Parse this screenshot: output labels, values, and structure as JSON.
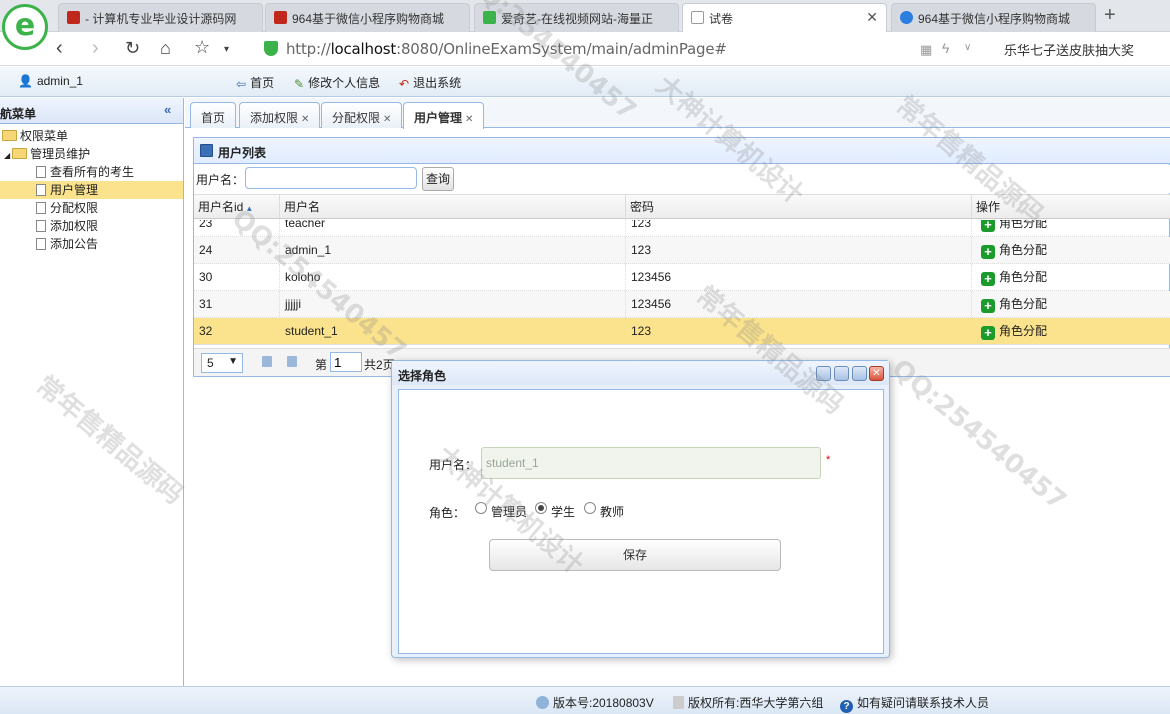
{
  "browser": {
    "tabs": [
      {
        "title": "- 计算机专业毕业设计源码网",
        "favicon_color": "#c0281b"
      },
      {
        "title": "964基于微信小程序购物商城",
        "favicon_color": "#c0281b"
      },
      {
        "title": "爱奇艺-在线视频网站-海量正",
        "favicon_color": "#3cb34a"
      },
      {
        "title": "试卷",
        "favicon_color": "#999999",
        "active": true
      },
      {
        "title": "964基于微信小程序购物商城",
        "favicon_color": "#2a7ee0"
      }
    ],
    "url_prefix": "http://",
    "url_host": "localhost",
    "url_rest": ":8080/OnlineExamSystem/main/adminPage#",
    "promo": "乐华七子送皮肤抽大奖"
  },
  "header": {
    "user": "admin_1",
    "home": "首页",
    "edit_profile": "修改个人信息",
    "logout": "退出系统"
  },
  "sidebar": {
    "title": "导航菜单",
    "root": "权限菜单",
    "group": "管理员维护",
    "items": [
      "查看所有的考生",
      "用户管理",
      "分配权限",
      "添加权限",
      "添加公告"
    ],
    "selected": "用户管理"
  },
  "main_tabs": [
    "首页",
    "添加权限",
    "分配权限",
    "用户管理"
  ],
  "panel": {
    "title": "用户列表",
    "search_label": "用户名：",
    "search_value": "",
    "search_button": "查询",
    "columns": [
      "用户名id",
      "用户名",
      "密码",
      "操作"
    ],
    "rows": [
      {
        "id": "23",
        "name": "teacher",
        "password": "123",
        "action": "角色分配"
      },
      {
        "id": "24",
        "name": "admin_1",
        "password": "123",
        "action": "角色分配"
      },
      {
        "id": "30",
        "name": "koloho",
        "password": "123456",
        "action": "角色分配"
      },
      {
        "id": "31",
        "name": "jjjjji",
        "password": "123456",
        "action": "角色分配"
      },
      {
        "id": "32",
        "name": "student_1",
        "password": "123",
        "action": "角色分配"
      }
    ],
    "pager": {
      "page_size": "5",
      "page_label": "第",
      "page": "1",
      "total": "共2页"
    }
  },
  "dialog": {
    "title": "选择角色",
    "username_label": "用户名：",
    "username_value": "student_1",
    "required_mark": "*",
    "role_label": "角色：",
    "roles": [
      "管理员",
      "学生",
      "教师"
    ],
    "selected_role": "学生",
    "save": "保存"
  },
  "footer": {
    "version": "版本号:20180803V",
    "copyright": "版权所有:西华大学第六组",
    "contact": "如有疑问请联系技术人员"
  },
  "watermark": [
    "QQ:254540457",
    "大神计算机设计",
    "常年售精品源码"
  ]
}
